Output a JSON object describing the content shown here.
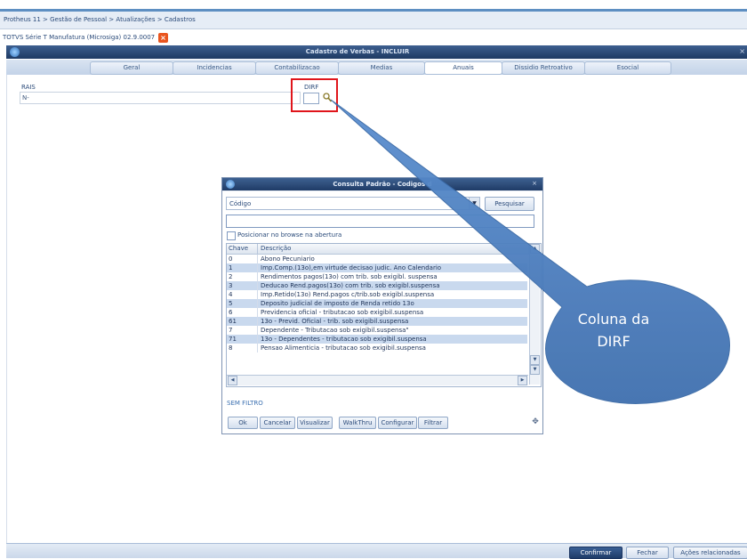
{
  "breadcrumb": "Protheus 11 > Gestão de Pessoal > Atualizações > Cadastros",
  "app_subtitle": "TOTVS Série T Manufatura (Microsiga) 02.9.0007",
  "window": {
    "title": "Cadastro de Verbas - INCLUIR",
    "close_glyph": "×"
  },
  "tabs": [
    {
      "label": "Geral"
    },
    {
      "label": "Incidencias"
    },
    {
      "label": "Contabilizacao"
    },
    {
      "label": "Medias"
    },
    {
      "label": "Anuais"
    },
    {
      "label": "Dissidio Retroativo"
    },
    {
      "label": "Esocial"
    }
  ],
  "active_tab": "Anuais",
  "form": {
    "rais_label": "RAIS",
    "rais_value": "N-",
    "dirf_label": "DIRF",
    "dirf_value": ""
  },
  "dialog": {
    "title": "Consulta Padrão - Codigos d",
    "search_by": "Código",
    "search_button": "Pesquisar",
    "search_value": "",
    "position_checkbox_label": "Posicionar no browse na abertura",
    "position_checked": false,
    "columns": [
      "Chave",
      "Descrição"
    ],
    "rows": [
      {
        "key": "0",
        "desc": "Abono Pecuniario"
      },
      {
        "key": "1",
        "desc": "Imp.Comp.(13o),em virtude decisao judic. Ano Calendario"
      },
      {
        "key": "2",
        "desc": "Rendimentos pagos(13o) com trib. sob exigibl. suspensa"
      },
      {
        "key": "3",
        "desc": "Deducao Rend.pagos(13o) com trib. sob exigibl.suspensa"
      },
      {
        "key": "4",
        "desc": "Imp.Retido(13o) Rend.pagos c/trib.sob exigibl.suspensa"
      },
      {
        "key": "5",
        "desc": "Deposito judicial de imposto de Renda retido 13o"
      },
      {
        "key": "6",
        "desc": "Previdencia oficial - tributacao sob exigibil.suspensa"
      },
      {
        "key": "61",
        "desc": "13o - Previd. Oficial - trib. sob exigibil.suspensa"
      },
      {
        "key": "7",
        "desc": "Dependente - Tributacao sob exigibil.suspensa\""
      },
      {
        "key": "71",
        "desc": "13o - Dependentes - tributacao sob exigibil.suspensa"
      },
      {
        "key": "8",
        "desc": "Pensao Alimenticia - tributacao sob exigibil.suspensa"
      }
    ],
    "filter_status": "SEM FILTRO",
    "buttons": [
      "Ok",
      "Cancelar",
      "Visualizar",
      "WalkThru",
      "Configurar",
      "Filtrar"
    ]
  },
  "callout": {
    "line1": "Coluna da",
    "line2": "DIRF",
    "color": "#4a7fc1"
  },
  "highlight_color": "#e0151b",
  "bottom_buttons": {
    "confirm": "Confirmar",
    "close": "Fechar",
    "actions": "Ações relacionadas"
  }
}
